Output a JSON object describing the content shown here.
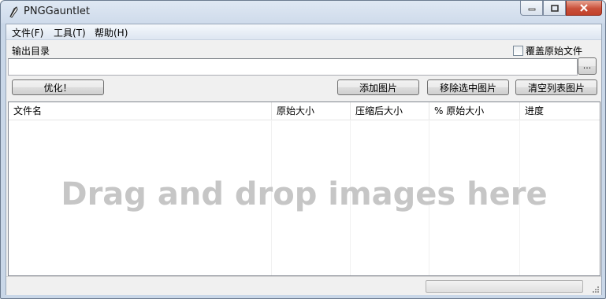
{
  "window": {
    "title": "PNGGauntlet",
    "icon": "pen-nib-icon",
    "controls": {
      "minimize": "minimize-icon",
      "maximize": "maximize-icon",
      "close": "close-icon"
    }
  },
  "menu": [
    {
      "label": "文件(F)"
    },
    {
      "label": "工具(T)"
    },
    {
      "label": "帮助(H)"
    }
  ],
  "output": {
    "label": "输出目录",
    "value": "",
    "browse_label": "...",
    "overwrite_label": "覆盖原始文件",
    "overwrite_checked": false
  },
  "actions": {
    "optimize": "优化！",
    "add": "添加图片",
    "remove": "移除选中图片",
    "clear": "清空列表图片"
  },
  "list": {
    "columns": [
      "文件名",
      "原始大小",
      "压缩后大小",
      "% 原始大小",
      "进度"
    ],
    "rows": [],
    "empty_hint": "Drag and drop images here"
  },
  "status": {
    "progress": 0
  },
  "colors": {
    "accent": "#cfdbeb",
    "close_button": "#c9503a",
    "watermark": "#c6c6c6"
  }
}
